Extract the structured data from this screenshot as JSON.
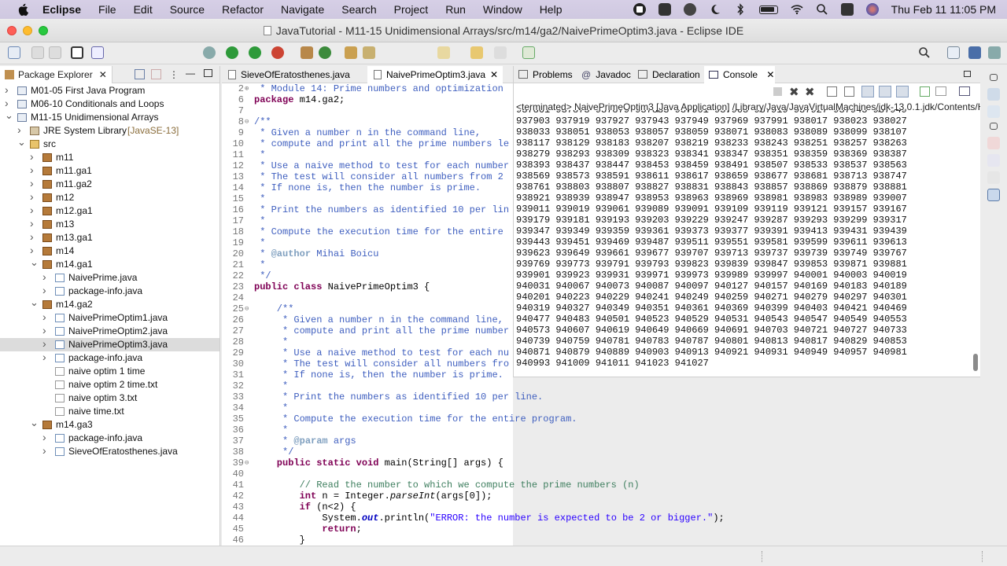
{
  "menubar": {
    "app": "Eclipse",
    "items": [
      "File",
      "Edit",
      "Source",
      "Refactor",
      "Navigate",
      "Search",
      "Project",
      "Run",
      "Window",
      "Help"
    ],
    "clock": "Thu Feb 11  11:05 PM"
  },
  "window": {
    "title": "JavaTutorial - M11-15 Unidimensional Arrays/src/m14/ga2/NaivePrimeOptim3.java - Eclipse IDE"
  },
  "package_explorer": {
    "tab_label": "Package Explorer",
    "tree": [
      {
        "label": "M01-05 First Java Program",
        "depth": 0,
        "icon": "project-icon",
        "twisty": "closed"
      },
      {
        "label": "M06-10 Conditionals and Loops",
        "depth": 0,
        "icon": "project-icon",
        "twisty": "closed"
      },
      {
        "label": "M11-15 Unidimensional Arrays",
        "depth": 0,
        "icon": "project-icon",
        "twisty": "open"
      },
      {
        "label": "JRE System Library",
        "decoration": "[JavaSE-13]",
        "depth": 1,
        "icon": "library-icon",
        "twisty": "closed"
      },
      {
        "label": "src",
        "depth": 1,
        "icon": "source-folder-icon",
        "twisty": "open"
      },
      {
        "label": "m11",
        "depth": 2,
        "icon": "package-icon",
        "twisty": "closed"
      },
      {
        "label": "m11.ga1",
        "depth": 2,
        "icon": "package-icon",
        "twisty": "closed"
      },
      {
        "label": "m11.ga2",
        "depth": 2,
        "icon": "package-icon",
        "twisty": "closed"
      },
      {
        "label": "m12",
        "depth": 2,
        "icon": "package-icon",
        "twisty": "closed"
      },
      {
        "label": "m12.ga1",
        "depth": 2,
        "icon": "package-icon",
        "twisty": "closed"
      },
      {
        "label": "m13",
        "depth": 2,
        "icon": "package-icon",
        "twisty": "closed"
      },
      {
        "label": "m13.ga1",
        "depth": 2,
        "icon": "package-icon",
        "twisty": "closed"
      },
      {
        "label": "m14",
        "depth": 2,
        "icon": "package-icon",
        "twisty": "closed"
      },
      {
        "label": "m14.ga1",
        "depth": 2,
        "icon": "package-icon",
        "twisty": "open"
      },
      {
        "label": "NaivePrime.java",
        "depth": 3,
        "icon": "java-file-icon",
        "twisty": "closed"
      },
      {
        "label": "package-info.java",
        "depth": 3,
        "icon": "java-file-icon",
        "twisty": "closed"
      },
      {
        "label": "m14.ga2",
        "depth": 2,
        "icon": "package-icon",
        "twisty": "open"
      },
      {
        "label": "NaivePrimeOptim1.java",
        "depth": 3,
        "icon": "java-file-icon",
        "twisty": "closed"
      },
      {
        "label": "NaivePrimeOptim2.java",
        "depth": 3,
        "icon": "java-file-icon",
        "twisty": "closed"
      },
      {
        "label": "NaivePrimeOptim3.java",
        "depth": 3,
        "icon": "java-file-icon",
        "twisty": "closed",
        "selected": true
      },
      {
        "label": "package-info.java",
        "depth": 3,
        "icon": "java-file-icon",
        "twisty": "closed"
      },
      {
        "label": "naive optim 1 time",
        "depth": 3,
        "icon": "text-file-icon",
        "twisty": "none"
      },
      {
        "label": "naive optim 2 time.txt",
        "depth": 3,
        "icon": "text-file-icon",
        "twisty": "none"
      },
      {
        "label": "naive optim 3.txt",
        "depth": 3,
        "icon": "text-file-icon",
        "twisty": "none"
      },
      {
        "label": "naive time.txt",
        "depth": 3,
        "icon": "text-file-icon",
        "twisty": "none"
      },
      {
        "label": "m14.ga3",
        "depth": 2,
        "icon": "package-icon",
        "twisty": "open"
      },
      {
        "label": "package-info.java",
        "depth": 3,
        "icon": "java-file-icon",
        "twisty": "closed"
      },
      {
        "label": "SieveOfEratosthenes.java",
        "depth": 3,
        "icon": "java-file-icon",
        "twisty": "closed"
      }
    ]
  },
  "editor": {
    "tabs": [
      "SieveOfEratosthenes.java",
      "NaivePrimeOptim3.java"
    ],
    "lines": [
      {
        "n": "2",
        "fold": "+",
        "cls": "jd",
        "text": " * Module 14: Prime numbers and optimization"
      },
      {
        "n": "6",
        "fold": "",
        "cls": "",
        "segs": [
          [
            "kw",
            "package"
          ],
          [
            "",
            " m14.ga2;"
          ]
        ]
      },
      {
        "n": "7",
        "fold": "",
        "cls": "",
        "text": ""
      },
      {
        "n": "8",
        "fold": "-",
        "cls": "jd",
        "text": "/**"
      },
      {
        "n": "9",
        "fold": "",
        "cls": "jd",
        "text": " * Given a number n in the command line,"
      },
      {
        "n": "10",
        "fold": "",
        "cls": "jd",
        "text": " * compute and print all the prime numbers le"
      },
      {
        "n": "11",
        "fold": "",
        "cls": "jd",
        "text": " *"
      },
      {
        "n": "12",
        "fold": "",
        "cls": "jd",
        "text": " * Use a naive method to test for each number"
      },
      {
        "n": "13",
        "fold": "",
        "cls": "jd",
        "text": " * The test will consider all numbers from 2"
      },
      {
        "n": "14",
        "fold": "",
        "cls": "jd",
        "text": " * If none is, then the number is prime."
      },
      {
        "n": "15",
        "fold": "",
        "cls": "jd",
        "text": " *"
      },
      {
        "n": "16",
        "fold": "",
        "cls": "jd",
        "text": " * Print the numbers as identified 10 per lin"
      },
      {
        "n": "17",
        "fold": "",
        "cls": "jd",
        "text": " *"
      },
      {
        "n": "18",
        "fold": "",
        "cls": "jd",
        "text": " * Compute the execution time for the entire"
      },
      {
        "n": "19",
        "fold": "",
        "cls": "jd",
        "text": " *"
      },
      {
        "n": "20",
        "fold": "",
        "cls": "",
        "segs": [
          [
            "jd",
            " * "
          ],
          [
            "tag",
            "@author"
          ],
          [
            "jd",
            " Mihai Boicu"
          ]
        ]
      },
      {
        "n": "21",
        "fold": "",
        "cls": "jd",
        "text": " *"
      },
      {
        "n": "22",
        "fold": "",
        "cls": "jd",
        "text": " */"
      },
      {
        "n": "23",
        "fold": "",
        "cls": "",
        "segs": [
          [
            "kw",
            "public class"
          ],
          [
            "",
            " NaivePrimeOptim3 {"
          ]
        ]
      },
      {
        "n": "24",
        "fold": "",
        "cls": "",
        "text": ""
      },
      {
        "n": "25",
        "fold": "-",
        "cls": "jd",
        "text": "    /**"
      },
      {
        "n": "26",
        "fold": "",
        "cls": "jd",
        "text": "     * Given a number n in the command line,"
      },
      {
        "n": "27",
        "fold": "",
        "cls": "jd",
        "text": "     * compute and print all the prime number"
      },
      {
        "n": "28",
        "fold": "",
        "cls": "jd",
        "text": "     *"
      },
      {
        "n": "29",
        "fold": "",
        "cls": "jd",
        "text": "     * Use a naive method to test for each nu"
      },
      {
        "n": "30",
        "fold": "",
        "cls": "jd",
        "text": "     * The test will consider all numbers fro"
      },
      {
        "n": "31",
        "fold": "",
        "cls": "jd",
        "text": "     * If none is, then the number is prime."
      },
      {
        "n": "32",
        "fold": "",
        "cls": "jd",
        "text": "     *"
      },
      {
        "n": "33",
        "fold": "",
        "cls": "jd",
        "text": "     * Print the numbers as identified 10 per line."
      },
      {
        "n": "34",
        "fold": "",
        "cls": "jd",
        "text": "     *"
      },
      {
        "n": "35",
        "fold": "",
        "cls": "jd",
        "text": "     * Compute the execution time for the entire program."
      },
      {
        "n": "36",
        "fold": "",
        "cls": "jd",
        "text": "     *"
      },
      {
        "n": "37",
        "fold": "",
        "cls": "",
        "segs": [
          [
            "jd",
            "     * "
          ],
          [
            "tag",
            "@param"
          ],
          [
            "jd",
            " args"
          ]
        ]
      },
      {
        "n": "38",
        "fold": "",
        "cls": "jd",
        "text": "     */"
      },
      {
        "n": "39",
        "fold": "-",
        "cls": "",
        "segs": [
          [
            "kw",
            "    public static void"
          ],
          [
            "",
            " main(String[] args) {"
          ]
        ]
      },
      {
        "n": "40",
        "fold": "",
        "cls": "",
        "text": ""
      },
      {
        "n": "41",
        "fold": "",
        "cls": "cm",
        "text": "        // Read the number to which we compute the prime numbers (n)"
      },
      {
        "n": "42",
        "fold": "",
        "cls": "",
        "segs": [
          [
            "kw",
            "        int"
          ],
          [
            "",
            " n = Integer."
          ],
          [
            "it",
            "parseInt"
          ],
          [
            "",
            "(args[0]);"
          ]
        ]
      },
      {
        "n": "43",
        "fold": "",
        "cls": "",
        "segs": [
          [
            "kw",
            "        if"
          ],
          [
            "",
            " (n<2) {"
          ]
        ]
      },
      {
        "n": "44",
        "fold": "",
        "cls": "",
        "segs": [
          [
            "",
            "            System."
          ],
          [
            "fld",
            "out"
          ],
          [
            "",
            ".println("
          ],
          [
            "str",
            "\"ERROR: the number is expected to be 2 or bigger.\""
          ],
          [
            "",
            ");"
          ]
        ]
      },
      {
        "n": "45",
        "fold": "",
        "cls": "",
        "segs": [
          [
            "kw",
            "            return"
          ],
          [
            "",
            ";"
          ]
        ]
      },
      {
        "n": "46",
        "fold": "",
        "cls": "",
        "text": "        }"
      }
    ]
  },
  "console_view": {
    "tabs": [
      "Problems",
      "Javadoc",
      "Declaration",
      "Console"
    ],
    "terminated_line": "<terminated> NaivePrimeOptim3 [Java Application] /Library/Java/JavaVirtualMachines/jdk-13.0.1.jdk/Contents/H",
    "rows": [
      "937861 937873 937879 937883 937901 937903 937919 937927 937943 937949",
      "937903 937919 937927 937943 937949 937969 937991 938017 938023 938027",
      "938033 938051 938053 938057 938059 938071 938083 938089 938099 938107",
      "938117 938129 938183 938207 938219 938233 938243 938251 938257 938263",
      "938279 938293 938309 938323 938341 938347 938351 938359 938369 938387",
      "938393 938437 938447 938453 938459 938491 938507 938533 938537 938563",
      "938569 938573 938591 938611 938617 938659 938677 938681 938713 938747",
      "938761 938803 938807 938827 938831 938843 938857 938869 938879 938881",
      "938921 938939 938947 938953 938963 938969 938981 938983 938989 939007",
      "939011 939019 939061 939089 939091 939109 939119 939121 939157 939167",
      "939179 939181 939193 939203 939229 939247 939287 939293 939299 939317",
      "939347 939349 939359 939361 939373 939377 939391 939413 939431 939439",
      "939443 939451 939469 939487 939511 939551 939581 939599 939611 939613",
      "939623 939649 939661 939677 939707 939713 939737 939739 939749 939767",
      "939769 939773 939791 939793 939823 939839 939847 939853 939871 939881",
      "939901 939923 939931 939971 939973 939989 939997 940001 940003 940019",
      "940031 940067 940073 940087 940097 940127 940157 940169 940183 940189",
      "940201 940223 940229 940241 940249 940259 940271 940279 940297 940301",
      "940319 940327 940349 940351 940361 940369 940399 940403 940421 940469",
      "940477 940483 940501 940523 940529 940531 940543 940547 940549 940553",
      "940573 940607 940619 940649 940669 940691 940703 940721 940727 940733",
      "940739 940759 940781 940783 940787 940801 940813 940817 940829 940853",
      "940871 940879 940889 940903 940913 940921 940931 940949 940957 940981",
      "940993 941009 941011 941023 941027"
    ]
  },
  "colors": {
    "menubar": "#d3cce4",
    "selection": "#dcdcdc",
    "keyword": "#7f0055",
    "javadoc": "#3f5fbf",
    "comment": "#3f7f5f",
    "string": "#2a00ff"
  }
}
